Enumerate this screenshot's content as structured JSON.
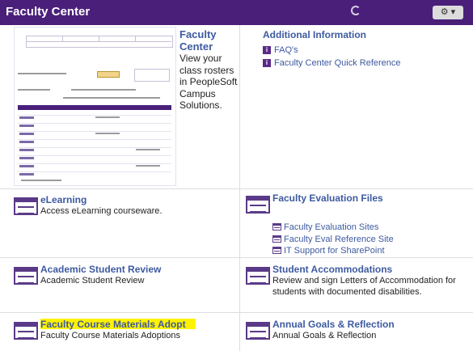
{
  "header": {
    "title": "Faculty Center",
    "options_icon": "gear-icon"
  },
  "faculty_center": {
    "title": "Faculty Center",
    "description": "View your class rosters in PeopleSoft Campus Solutions."
  },
  "additional_info": {
    "title": "Additional Information",
    "links": [
      "FAQ's",
      "Faculty Center Quick Reference"
    ]
  },
  "elearning": {
    "title": "eLearning",
    "description": "Access eLearning courseware."
  },
  "faculty_eval": {
    "title": "Faculty Evaluation Files",
    "links": [
      "Faculty Evaluation Sites",
      "Faculty Eval Reference Site",
      "IT Support for SharePoint"
    ]
  },
  "academic_review": {
    "title": "Academic Student Review",
    "description": "Academic Student Review"
  },
  "student_accom": {
    "title": "Student Accommodations",
    "description": "Review and sign Letters of Accommodation for students with documented disabilities."
  },
  "course_materials": {
    "title": "Faculty Course Materials Adopt",
    "description": "Faculty Course Materials Adoptions"
  },
  "annual_goals": {
    "title": "Annual Goals & Reflection",
    "description": "Annual Goals & Reflection"
  },
  "colors": {
    "header_bg": "#4a1f7a",
    "link": "#3d5aa0",
    "highlight": "#fff200"
  }
}
